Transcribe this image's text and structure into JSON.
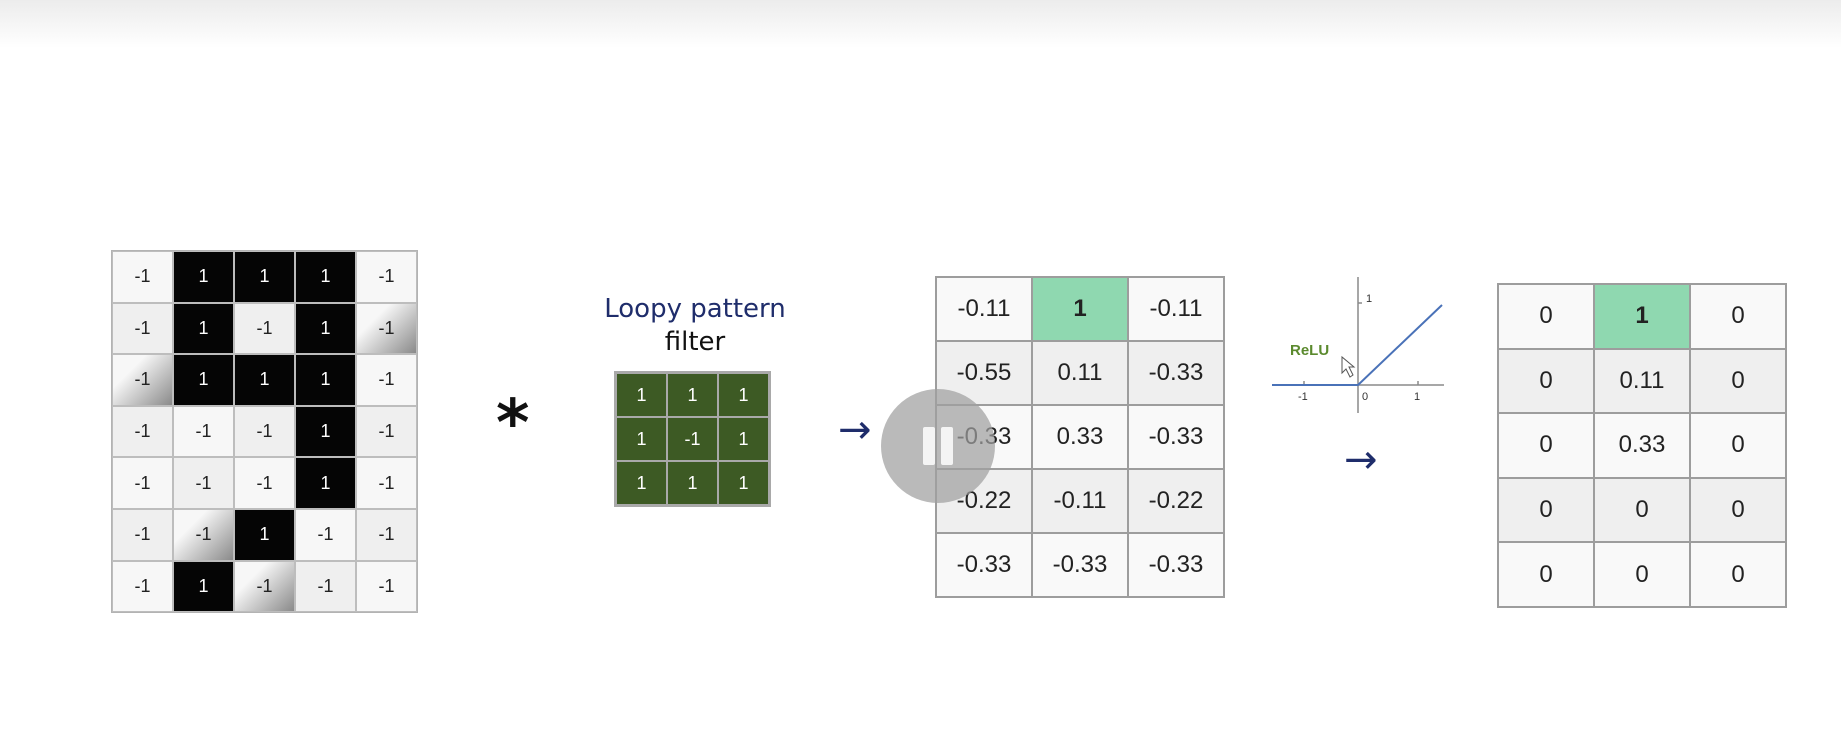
{
  "input_matrix": [
    [
      "-1",
      "1",
      "1",
      "1",
      "-1"
    ],
    [
      "-1",
      "1",
      "-1",
      "1",
      "-1"
    ],
    [
      "-1",
      "1",
      "1",
      "1",
      "-1"
    ],
    [
      "-1",
      "-1",
      "-1",
      "1",
      "-1"
    ],
    [
      "-1",
      "-1",
      "-1",
      "1",
      "-1"
    ],
    [
      "-1",
      "-1",
      "1",
      "-1",
      "-1"
    ],
    [
      "-1",
      "1",
      "-1",
      "-1",
      "-1"
    ]
  ],
  "operator": "*",
  "filter": {
    "title_line1": "Loopy pattern",
    "title_line2": "filter",
    "matrix": [
      [
        "1",
        "1",
        "1"
      ],
      [
        "1",
        "-1",
        "1"
      ],
      [
        "1",
        "1",
        "1"
      ]
    ],
    "color": "#3d5a24"
  },
  "arrow_glyph": "→",
  "conv_output": [
    [
      "-0.11",
      "1",
      "-0.11"
    ],
    [
      "-0.55",
      "0.11",
      "-0.33"
    ],
    [
      "-0.33",
      "0.33",
      "-0.33"
    ],
    [
      "-0.22",
      "-0.11",
      "-0.22"
    ],
    [
      "-0.33",
      "-0.33",
      "-0.33"
    ]
  ],
  "relu": {
    "label": "ReLU",
    "y_tick": "1",
    "x_ticks": [
      "-1",
      "0",
      "1"
    ],
    "line_color": "#4a72b8",
    "label_color": "#5b8a2e"
  },
  "relu_output": [
    [
      "0",
      "1",
      "0"
    ],
    [
      "0",
      "0.11",
      "0"
    ],
    [
      "0",
      "0.33",
      "0"
    ],
    [
      "0",
      "0",
      "0"
    ],
    [
      "0",
      "0",
      "0"
    ]
  ],
  "highlight_color": "#8fd8b0"
}
